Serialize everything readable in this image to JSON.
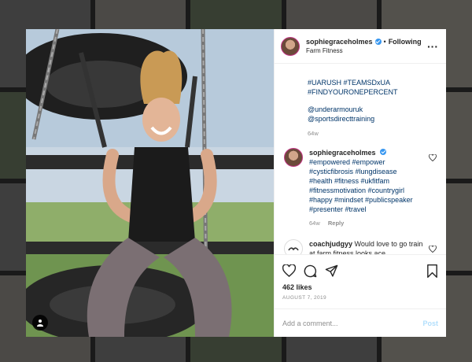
{
  "post": {
    "username": "sophiegraceholmes",
    "follow_status": "Following",
    "location": "Farm Fitness",
    "caption_tags_a": [
      "#UARUSH #TEAMSDxUA",
      "#FINDYOURONEPERCENT"
    ],
    "caption_mentions": [
      "@underarmouruk",
      "@sportsdirecttraining"
    ],
    "caption_time": "64w",
    "likes": "462 likes",
    "date": "August 7, 2019"
  },
  "comments": [
    {
      "username": "sophiegraceholmes",
      "text_lines": [
        "#empowered #empower",
        "#cysticfibrosis #lungdisease",
        "#health #fitness #ukfitfam",
        "#fitnessmotivation #countrygirl",
        "#happy #mindset #publicspeaker",
        "#presenter #travel"
      ],
      "time": "64w",
      "reply": "Reply"
    },
    {
      "username": "coachjudgyy",
      "text": "Would love to go train at farm fitness looks ace"
    }
  ],
  "add_comment": {
    "placeholder": "Add a comment...",
    "post_label": "Post"
  },
  "icons": {
    "verified": "verified-badge-icon",
    "more": "more-options-icon",
    "like": "heart-icon",
    "comment": "comment-icon",
    "share": "share-icon",
    "save": "bookmark-icon",
    "tags": "user-tag-icon"
  },
  "colors": {
    "verified": "#3897f0",
    "link": "#003569",
    "muted": "#8e8e8e",
    "post_button": "#b2dffc"
  }
}
